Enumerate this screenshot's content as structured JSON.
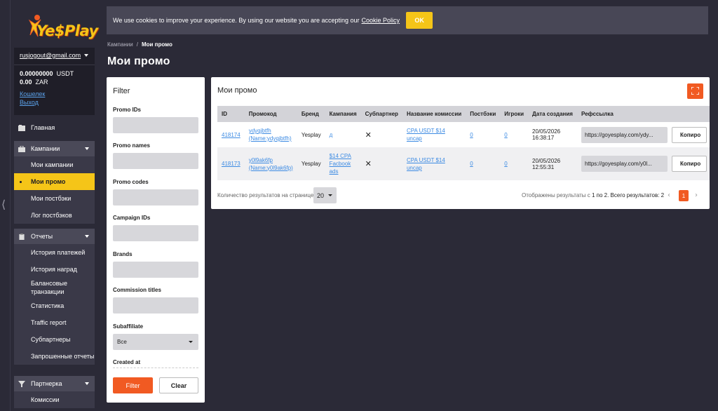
{
  "cookie": {
    "text": "We use cookies to improve your experience. By using our website you are accepting our",
    "link": "Cookie Policy",
    "ok": "OK"
  },
  "brand": {
    "logo": "YeSPlay"
  },
  "account": {
    "email": "rusjogout@gmail.com",
    "usdt_amount": "0.00000000",
    "usdt_cur": "USDT",
    "zar_amount": "0.00",
    "zar_cur": "ZAR",
    "wallet": "Кошелек",
    "logout": "Выход"
  },
  "sidebar": {
    "home": "Главная",
    "campaigns": {
      "label": "Кампании",
      "items": [
        "Мои кампании",
        "Мои промо",
        "Мои постбэки",
        "Лог постбэков"
      ]
    },
    "reports": {
      "label": "Отчеты",
      "items": [
        "История платежей",
        "История наград",
        "Балансовые транзакции",
        "Статистика",
        "Traffic report",
        "Субпартнеры",
        "Запрошенные отчеты"
      ]
    },
    "partner": {
      "label": "Партнерка",
      "items": [
        "Комиссии"
      ]
    }
  },
  "breadcrumb": {
    "parent": "Кампании",
    "sep": "/",
    "current": "Мои промо"
  },
  "page_title": "Мои промо",
  "filter": {
    "title": "Filter",
    "labels": [
      "Promo IDs",
      "Promo names",
      "Promo codes",
      "Campaign IDs",
      "Brands",
      "Commission titles",
      "Subaffiliate",
      "Created at"
    ],
    "subaffiliate_value": "Все",
    "filter_btn": "Filter",
    "clear_btn": "Clear"
  },
  "results": {
    "title": "Мои промо",
    "headers": [
      "ID",
      "Промокод",
      "Бренд",
      "Кампания",
      "Субпартнер",
      "Название комиссии",
      "Постбэки",
      "Игроки",
      "Дата создания",
      "Рефссылка"
    ],
    "rows": [
      {
        "id": "418174",
        "promo": "ydyqjbtfh (Name:ydyqjbtfh)",
        "brand": "Yesplay",
        "campaign": "д",
        "sub": "✕",
        "commission": "CPA USDT $14 uncap",
        "postbacks": "0",
        "players": "0",
        "created": "20/05/2026 16:38:17",
        "ref": "https://goyesplay.com/ydy...",
        "copy": "Копиро"
      },
      {
        "id": "418173",
        "promo": "y0l9ak6fp (Name:y0l9ak6fp)",
        "brand": "Yesplay",
        "campaign": "$14 CPA Facbook ads",
        "sub": "✕",
        "commission": "CPA USDT $14 uncap",
        "postbacks": "0",
        "players": "0",
        "created": "20/05/2026 12:55:31",
        "ref": "https://goyesplay.com/y0l...",
        "copy": "Копиро"
      }
    ],
    "per_page_label": "Количество результатов на странице",
    "per_page": "20",
    "summary_prefix": "Отображены результаты с",
    "summary_value": "1 по 2. Всего результатов: 2",
    "page": "1",
    "prev": "‹",
    "next": "›"
  },
  "colors": {
    "accent": "#f15a22",
    "yellow": "#f5c518",
    "link": "#3d8be3",
    "bg": "#2b2a37"
  }
}
